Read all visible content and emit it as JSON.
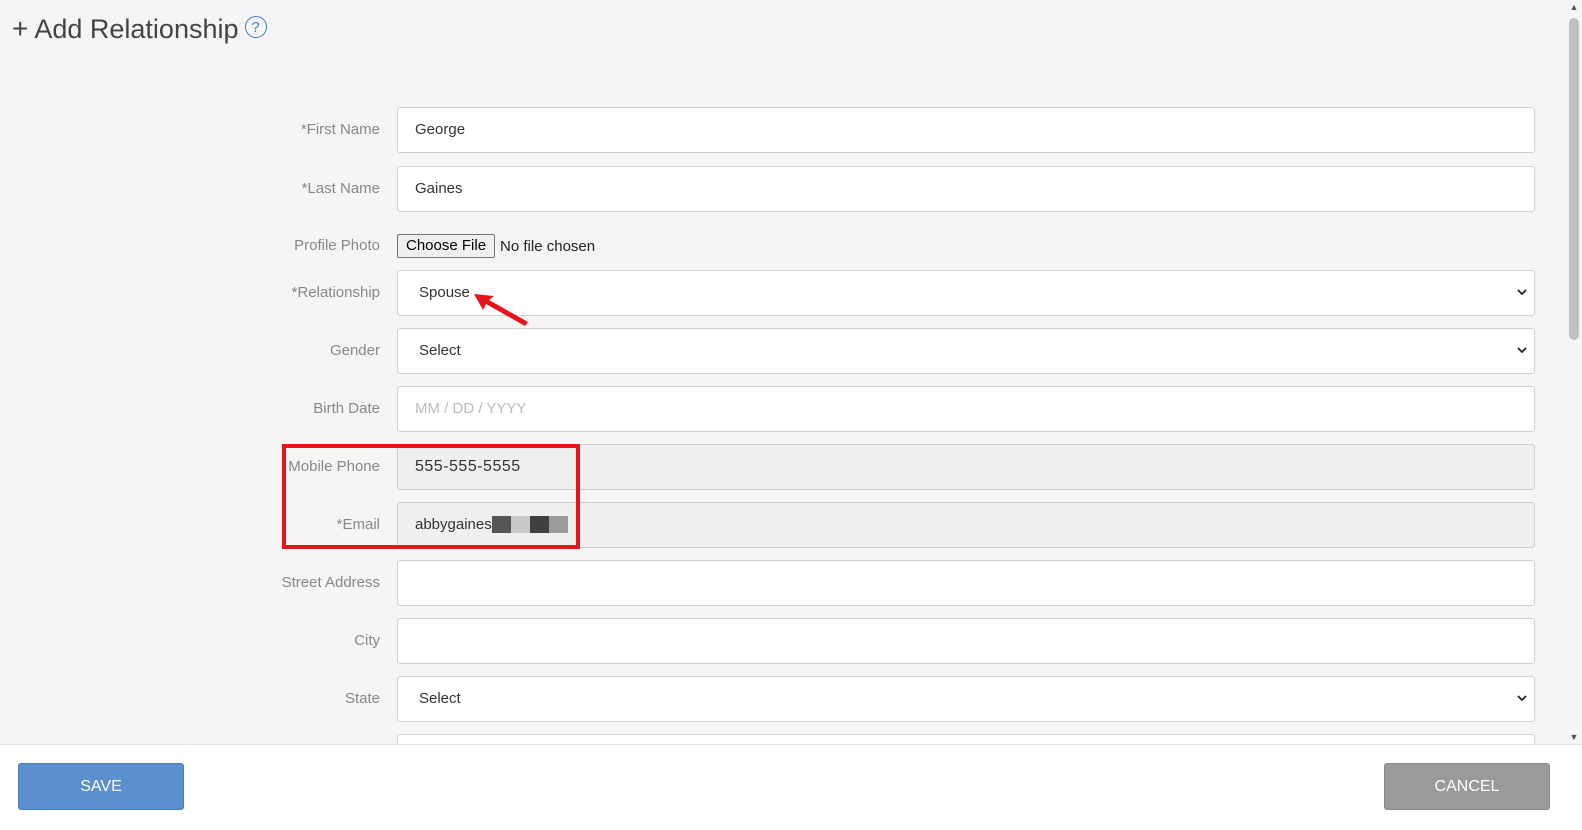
{
  "header": {
    "title": "Add Relationship",
    "plus_glyph": "+",
    "help_glyph": "?"
  },
  "form": {
    "first_name": {
      "label": "*First Name",
      "value": "George"
    },
    "last_name": {
      "label": "*Last Name",
      "value": "Gaines"
    },
    "profile_photo": {
      "label": "Profile Photo",
      "button": "Choose File",
      "status": "No file chosen"
    },
    "relationship": {
      "label": "*Relationship",
      "value": "Spouse"
    },
    "gender": {
      "label": "Gender",
      "value": "Select"
    },
    "birth_date": {
      "label": "Birth Date",
      "placeholder": "MM / DD / YYYY"
    },
    "mobile_phone": {
      "label": "Mobile Phone",
      "value": "555-555-5555"
    },
    "email": {
      "label": "*Email",
      "value": "abbygaines"
    },
    "street_address": {
      "label": "Street Address",
      "value": ""
    },
    "city": {
      "label": "City",
      "value": ""
    },
    "state": {
      "label": "State",
      "value": "Select"
    }
  },
  "footer": {
    "save_label": "SAVE",
    "cancel_label": "CANCEL"
  },
  "icons": {
    "chevron": "chevron-down-icon",
    "help": "help-circle-icon"
  },
  "colors": {
    "accent_blue": "#5b8fd0",
    "cancel_gray": "#9a9a9a",
    "annotation_red": "#e8141b"
  }
}
